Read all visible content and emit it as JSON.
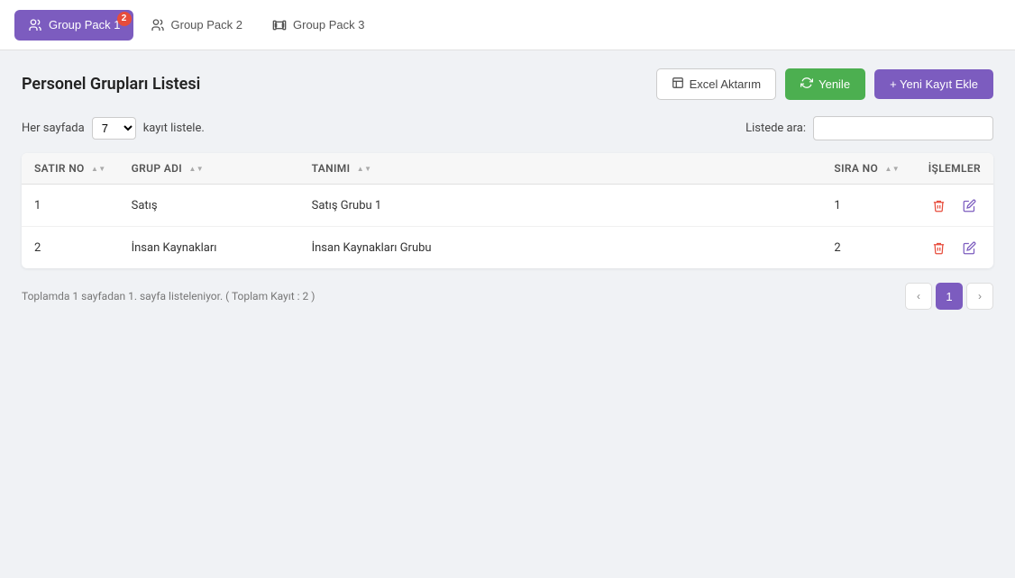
{
  "tabs": [
    {
      "id": "group-pack-1",
      "label": "Group Pack 1",
      "active": true,
      "badge": "2",
      "icon": "users"
    },
    {
      "id": "group-pack-2",
      "label": "Group Pack 2",
      "active": false,
      "badge": null,
      "icon": "users"
    },
    {
      "id": "group-pack-3",
      "label": "Group Pack 3",
      "active": false,
      "badge": null,
      "icon": "dumbbell"
    }
  ],
  "page": {
    "title": "Personel Grupları Listesi"
  },
  "actions": {
    "excel_label": "Excel Aktarım",
    "refresh_label": "Yenile",
    "new_label": "+ Yeni Kayıt Ekle"
  },
  "controls": {
    "per_page_label": "Her sayfada",
    "per_page_value": "7",
    "per_page_suffix": "kayıt listele.",
    "search_label": "Listede ara:",
    "search_placeholder": "",
    "search_value": ""
  },
  "table": {
    "columns": [
      {
        "key": "satir",
        "label": "SATIR NO",
        "sortable": true
      },
      {
        "key": "grup",
        "label": "GRUP ADI",
        "sortable": true
      },
      {
        "key": "tanim",
        "label": "TANIMI",
        "sortable": true
      },
      {
        "key": "sira",
        "label": "SIRA NO",
        "sortable": true
      },
      {
        "key": "islemler",
        "label": "İŞLEMLER",
        "sortable": false
      }
    ],
    "rows": [
      {
        "satir": "1",
        "grup": "Satış",
        "tanim": "Satış Grubu 1",
        "sira": "1"
      },
      {
        "satir": "2",
        "grup": "İnsan Kaynakları",
        "tanim": "İnsan Kaynakları Grubu",
        "sira": "2"
      }
    ]
  },
  "pagination": {
    "info": "Toplamda 1 sayfadan 1. sayfa listeleniyor. ( Toplam Kayıt : 2 )",
    "prev_label": "‹",
    "next_label": "›",
    "current_page": "1",
    "pages": [
      "1"
    ]
  }
}
